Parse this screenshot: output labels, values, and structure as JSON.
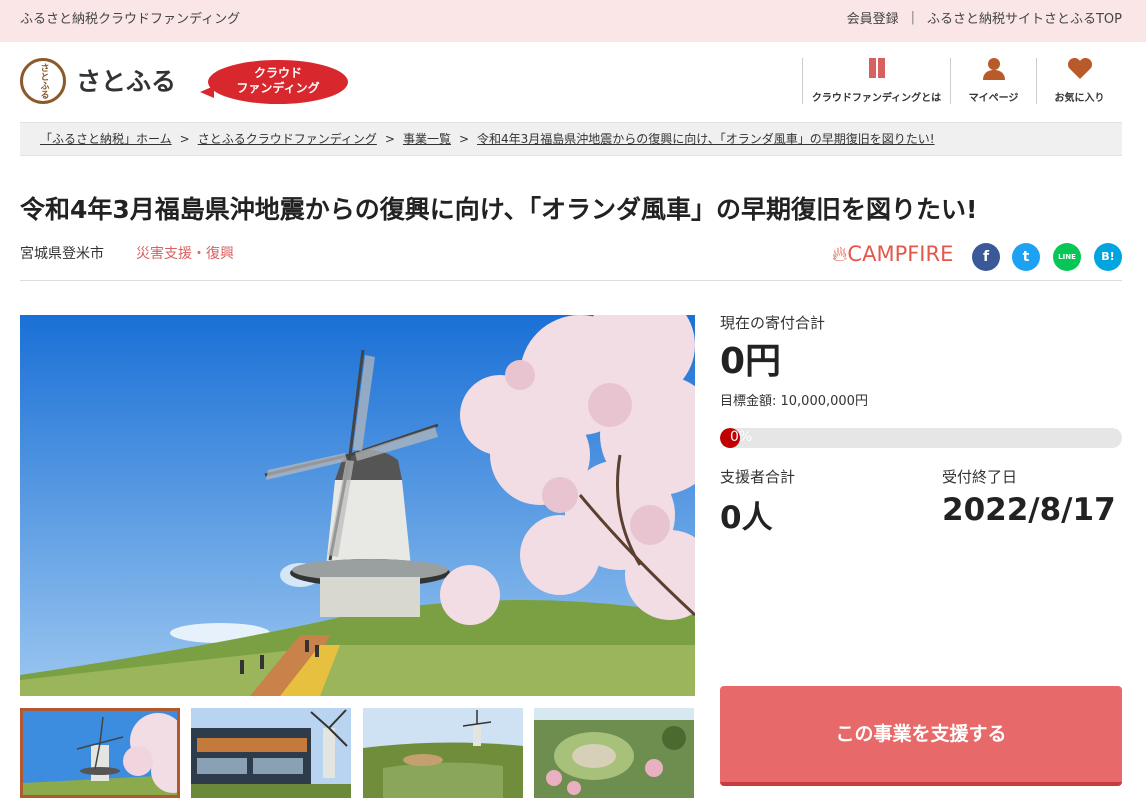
{
  "topbar": {
    "site_name": "ふるさと納税クラウドファンディング",
    "member_link": "会員登録",
    "separator": "|",
    "top_link": "ふるさと納税サイトさとふるTOP"
  },
  "header": {
    "logo_mark": "さとふる",
    "logo_text": "さとふる",
    "cf_badge_line1": "クラウド",
    "cf_badge_line2": "ファンディング",
    "nav": [
      {
        "label": "クラウドファンディングとは",
        "icon": "book-icon"
      },
      {
        "label": "マイページ",
        "icon": "user-icon"
      },
      {
        "label": "お気に入り",
        "icon": "heart-icon"
      }
    ]
  },
  "breadcrumb": [
    "「ふるさと納税」ホーム",
    "さとふるクラウドファンディング",
    "事業一覧",
    "令和4年3月福島県沖地震からの復興に向け、「オランダ風車」の早期復旧を図りたい!"
  ],
  "breadcrumb_sep": ">",
  "project": {
    "title": "令和4年3月福島県沖地震からの復興に向け、「オランダ風車」の早期復旧を図りたい!",
    "location": "宮城県登米市",
    "category": "災害支援・復興"
  },
  "share": {
    "partner": "CAMPFIRE",
    "facebook": "f",
    "twitter": "t",
    "line": "LINE",
    "hatena": "B!"
  },
  "stats": {
    "current_label": "現在の寄付合計",
    "current_value": "0円",
    "goal_text": "目標金額: 10,000,000円",
    "progress_text": "0%",
    "progress_fraction": 0.0,
    "supporters_label": "支援者合計",
    "supporters_value": "0人",
    "deadline_label": "受付終了日",
    "deadline_value": "2022/8/17"
  },
  "cta": {
    "support_button": "この事業を支援する"
  },
  "colors": {
    "topbar_bg": "#fae6e6",
    "accent_red": "#e86969",
    "brand_brown": "#8b5a2b",
    "category_red": "#d96060"
  }
}
